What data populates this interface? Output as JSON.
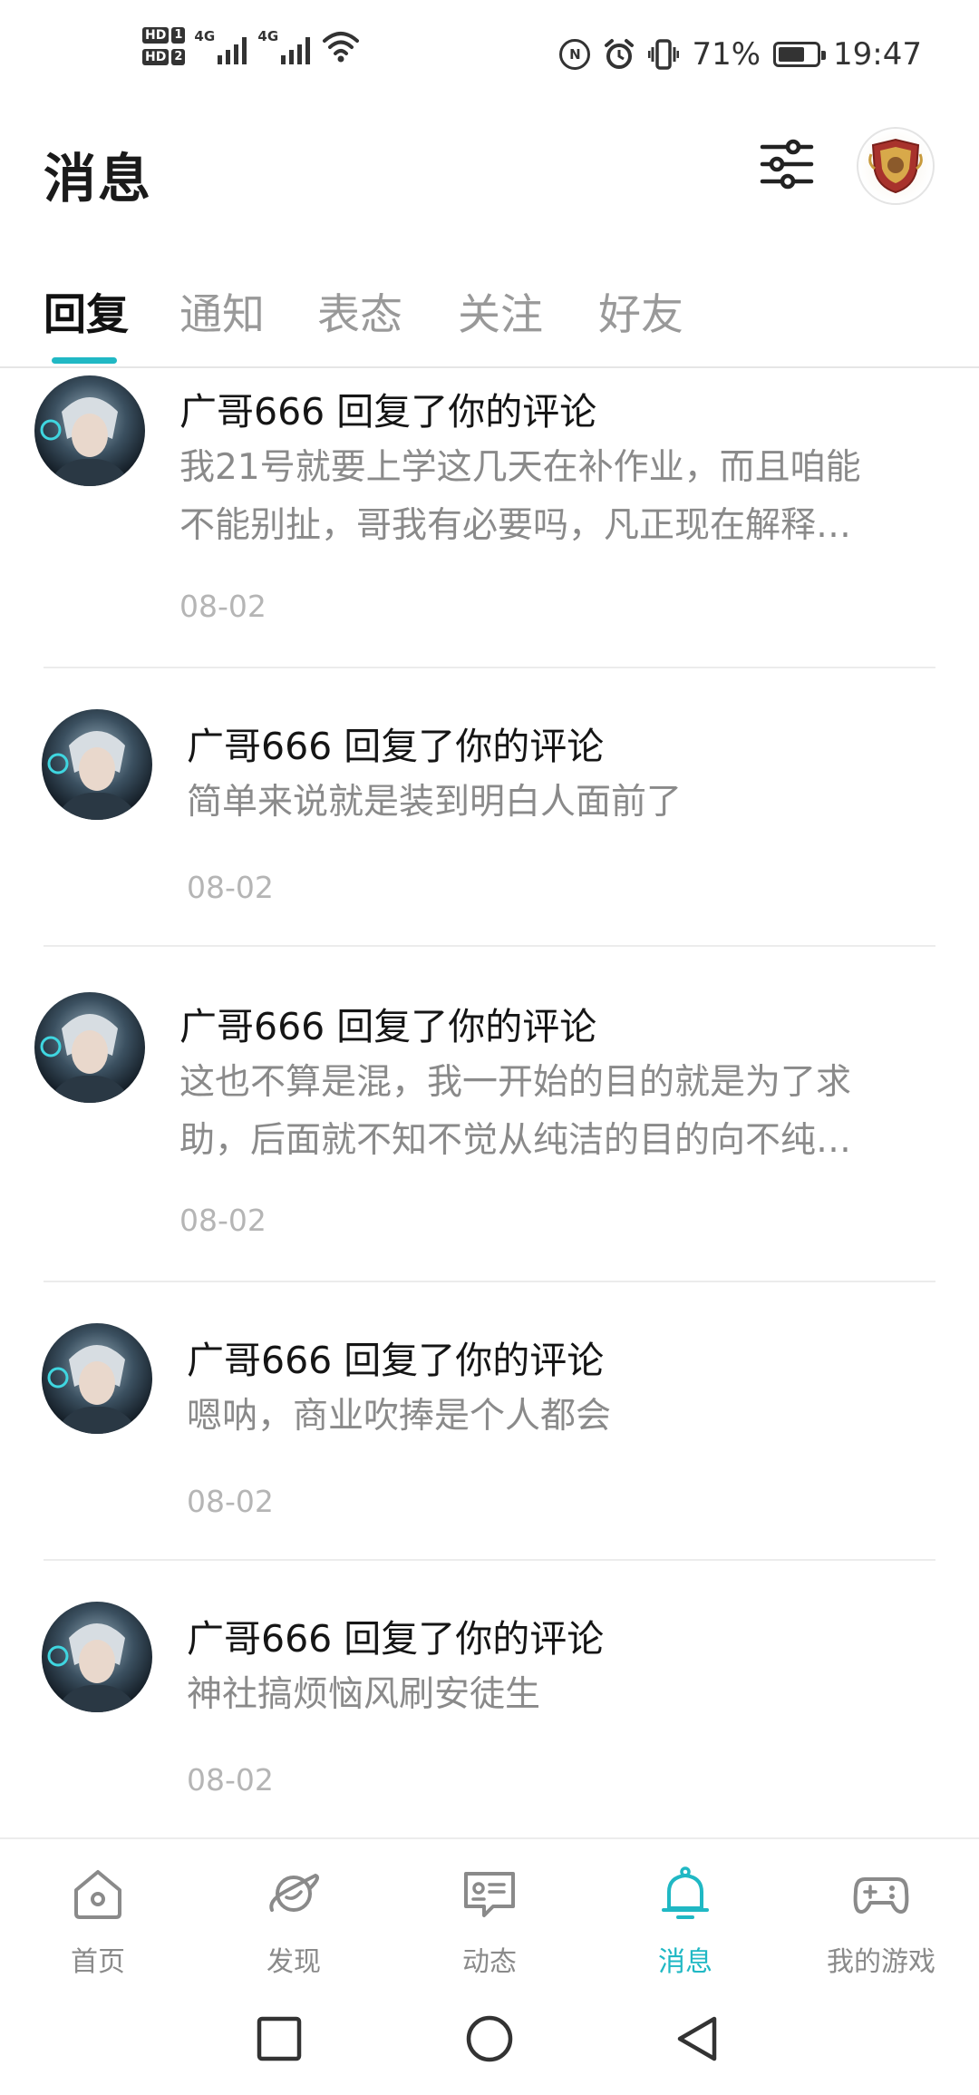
{
  "status_bar": {
    "hd1": "HD",
    "hd1_num": "1",
    "hd2": "HD",
    "hd2_num": "2",
    "net1": "4G",
    "net2": "4G",
    "battery_percent_text": "71%",
    "battery_level": 0.71,
    "time": "19:47",
    "data_icon_text": "N"
  },
  "header": {
    "title": "消息"
  },
  "tabs": [
    {
      "label": "回复",
      "active": true
    },
    {
      "label": "通知",
      "active": false
    },
    {
      "label": "表态",
      "active": false
    },
    {
      "label": "关注",
      "active": false
    },
    {
      "label": "好友",
      "active": false
    }
  ],
  "messages": [
    {
      "title": "广哥666 回复了你的评论",
      "line1": "我21号就要上学这几天在补作业，而且咱能",
      "line2": "不能别扯，哥我有必要吗，凡正现在解释…",
      "date": "08-02"
    },
    {
      "title": "广哥666 回复了你的评论",
      "line1": "简单来说就是装到明白人面前了",
      "line2": "",
      "date": "08-02"
    },
    {
      "title": "广哥666 回复了你的评论",
      "line1": "这也不算是混，我一开始的目的就是为了求",
      "line2": "助，后面就不知不觉从纯洁的目的向不纯…",
      "date": "08-02"
    },
    {
      "title": "广哥666 回复了你的评论",
      "line1": "嗯呐，商业吹捧是个人都会",
      "line2": "",
      "date": "08-02"
    },
    {
      "title": "广哥666 回复了你的评论",
      "line1": "神社搞烦恼风刷安徒生",
      "line2": "",
      "date": "08-02"
    }
  ],
  "bottom_nav": [
    {
      "label": "首页",
      "icon": "home-icon",
      "active": false
    },
    {
      "label": "发现",
      "icon": "planet-icon",
      "active": false
    },
    {
      "label": "动态",
      "icon": "chat-card-icon",
      "active": false
    },
    {
      "label": "消息",
      "icon": "bell-icon",
      "active": true
    },
    {
      "label": "我的游戏",
      "icon": "gamepad-icon",
      "active": false
    }
  ],
  "colors": {
    "accent": "#20b8c4",
    "muted": "#8a8a8a",
    "date": "#b5b5b5"
  }
}
